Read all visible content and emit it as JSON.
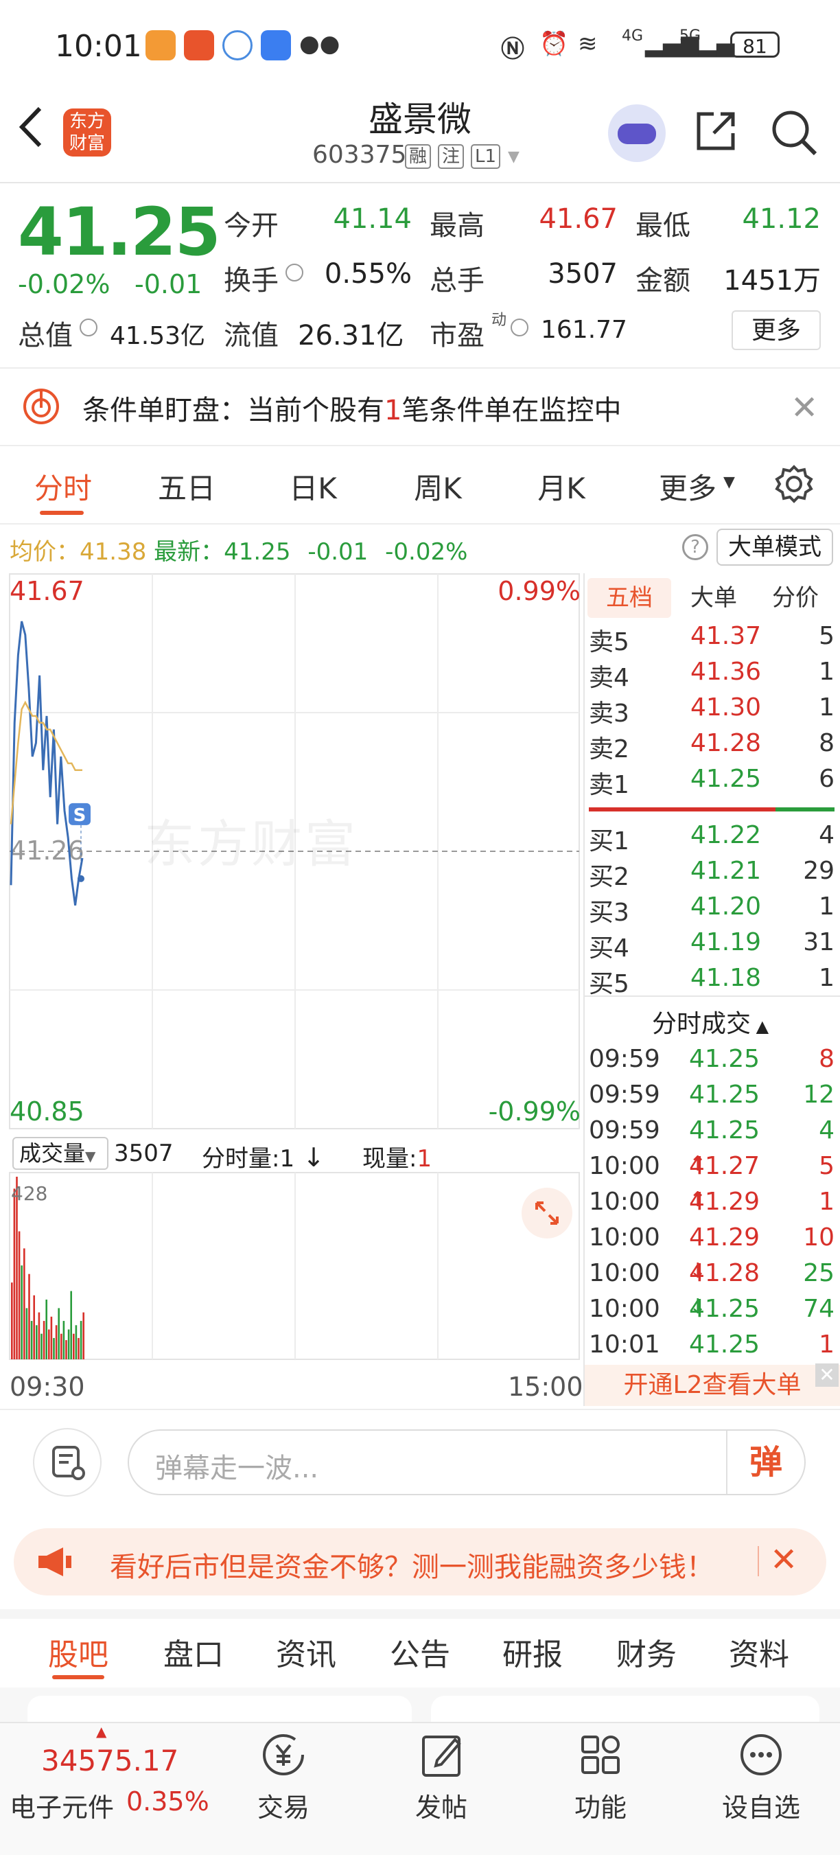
{
  "status_bar": {
    "time": "10:01",
    "network_4g": "4G",
    "network_5g": "5G",
    "battery": "81"
  },
  "header": {
    "back_icon": "chevron-left-icon",
    "logo_text": "东方财富",
    "stock_name": "盛景微",
    "stock_code": "603375",
    "tags": [
      "融",
      "注",
      "L1"
    ]
  },
  "quote": {
    "price": "41.25",
    "change_pct": "-0.02%",
    "change": "-0.01",
    "stats": [
      {
        "label": "今开",
        "value": "41.14",
        "color": "green"
      },
      {
        "label": "最高",
        "value": "41.67",
        "color": "red"
      },
      {
        "label": "最低",
        "value": "41.12",
        "color": "green"
      },
      {
        "label": "换手",
        "value": "0.55%",
        "color": "black"
      },
      {
        "label": "总手",
        "value": "3507",
        "color": "black"
      },
      {
        "label": "金额",
        "value": "1451万",
        "color": "black"
      }
    ],
    "total_value_label": "总值",
    "total_value": "41.53亿",
    "float_value_label": "流值",
    "float_value": "26.31亿",
    "pe_label": "市盈",
    "pe_sup": "动",
    "pe_value": "161.77",
    "more_button": "更多"
  },
  "condition": {
    "text_before": "条件单盯盘：当前个股有",
    "count": "1",
    "text_after": "笔条件单在监控中"
  },
  "chart_tabs": [
    "分时",
    "五日",
    "日K",
    "周K",
    "月K",
    "更多"
  ],
  "avg_line": {
    "avg_label": "均价：",
    "avg_value": "41.38",
    "latest_label": "最新：",
    "latest_value": "41.25",
    "latest_change": "-0.01",
    "latest_pct": "-0.02%",
    "big_mode": "大单模式"
  },
  "chart_data": {
    "type": "line",
    "y_top": "41.67",
    "y_mid": "41.26",
    "y_bottom": "40.85",
    "pct_top": "0.99%",
    "pct_bottom": "-0.99%",
    "ylim": [
      40.85,
      41.67
    ],
    "series": [
      {
        "values": [
          41.21,
          41.45,
          41.55,
          41.6,
          41.58,
          41.5,
          41.4,
          41.42,
          41.52,
          41.38,
          41.46,
          41.34,
          41.44,
          41.3,
          41.4,
          41.32,
          41.28,
          41.22,
          41.18,
          41.22,
          41.25
        ]
      },
      {
        "values": [
          41.3,
          41.36,
          41.42,
          41.47,
          41.48,
          41.47,
          41.46,
          41.46,
          41.45,
          41.45,
          41.44,
          41.44,
          41.43,
          41.42,
          41.41,
          41.4,
          41.39,
          41.39,
          41.38,
          41.38,
          41.38
        ]
      }
    ],
    "marker": "S",
    "volume": {
      "max_label": "428",
      "values": [
        180,
        400,
        428,
        300,
        220,
        260,
        120,
        200,
        90,
        150,
        80,
        110,
        60,
        90,
        140,
        70,
        100,
        50,
        80,
        120,
        60,
        90,
        45,
        70,
        160,
        60,
        80,
        50,
        90,
        110
      ],
      "colors": [
        "r",
        "r",
        "r",
        "r",
        "g",
        "r",
        "g",
        "r",
        "g",
        "r",
        "g",
        "r",
        "g",
        "r",
        "g",
        "r",
        "r",
        "g",
        "r",
        "g",
        "r",
        "g",
        "r",
        "g",
        "g",
        "r",
        "g",
        "r",
        "g",
        "r"
      ]
    },
    "time_start": "09:30",
    "time_end": "15:00"
  },
  "order_book": {
    "tabs": [
      "五档",
      "大单",
      "分价"
    ],
    "asks": [
      {
        "label": "卖5",
        "price": "41.37",
        "vol": "5",
        "color": "red"
      },
      {
        "label": "卖4",
        "price": "41.36",
        "vol": "1",
        "color": "red"
      },
      {
        "label": "卖3",
        "price": "41.30",
        "vol": "1",
        "color": "red"
      },
      {
        "label": "卖2",
        "price": "41.28",
        "vol": "8",
        "color": "red"
      },
      {
        "label": "卖1",
        "price": "41.25",
        "vol": "6",
        "color": "green"
      }
    ],
    "bids": [
      {
        "label": "买1",
        "price": "41.22",
        "vol": "4",
        "color": "green"
      },
      {
        "label": "买2",
        "price": "41.21",
        "vol": "29",
        "color": "green"
      },
      {
        "label": "买3",
        "price": "41.20",
        "vol": "1",
        "color": "green"
      },
      {
        "label": "买4",
        "price": "41.19",
        "vol": "31",
        "color": "green"
      },
      {
        "label": "买5",
        "price": "41.18",
        "vol": "1",
        "color": "green"
      }
    ],
    "ticks_title": "分时成交",
    "ticks": [
      {
        "time": "09:59",
        "price": "41.25",
        "arrow": "",
        "vol": "8",
        "pcolor": "green",
        "vcolor": "red"
      },
      {
        "time": "09:59",
        "price": "41.25",
        "arrow": "",
        "vol": "12",
        "pcolor": "green",
        "vcolor": "green"
      },
      {
        "time": "09:59",
        "price": "41.25",
        "arrow": "",
        "vol": "4",
        "pcolor": "green",
        "vcolor": "green"
      },
      {
        "time": "10:00",
        "price": "41.27",
        "arrow": "↑",
        "vol": "5",
        "pcolor": "red",
        "vcolor": "red"
      },
      {
        "time": "10:00",
        "price": "41.29",
        "arrow": "↑",
        "vol": "1",
        "pcolor": "red",
        "vcolor": "red"
      },
      {
        "time": "10:00",
        "price": "41.29",
        "arrow": "",
        "vol": "10",
        "pcolor": "red",
        "vcolor": "red"
      },
      {
        "time": "10:00",
        "price": "41.28",
        "arrow": "↓",
        "vol": "25",
        "pcolor": "red",
        "vcolor": "green"
      },
      {
        "time": "10:00",
        "price": "41.25",
        "arrow": "↓",
        "vol": "74",
        "pcolor": "green",
        "vcolor": "green"
      },
      {
        "time": "10:01",
        "price": "41.25",
        "arrow": "",
        "vol": "1",
        "pcolor": "green",
        "vcolor": "red"
      }
    ],
    "l2_banner": "开通L2查看大单"
  },
  "volume_header": {
    "select_label": "成交量",
    "total": "3507",
    "per_label": "分时量:1",
    "now_label": "现量:",
    "now_value": "1"
  },
  "watermark": "东方财富",
  "comment": {
    "placeholder": "弹幕走一波...",
    "danmu_button": "弹"
  },
  "promo": {
    "text": "看好后市但是资金不够？测一测我能融资多少钱！"
  },
  "bottom_tabs": [
    "股吧",
    "盘口",
    "资讯",
    "公告",
    "研报",
    "财务",
    "资料"
  ],
  "bottom_nav": {
    "index_value": "34575.17",
    "index_name": "电子元件",
    "index_pct": "0.35%",
    "items": [
      {
        "label": "交易",
        "icon": "yen-circle-icon"
      },
      {
        "label": "发帖",
        "icon": "edit-icon"
      },
      {
        "label": "功能",
        "icon": "grid-icon"
      },
      {
        "label": "设自选",
        "icon": "more-circle-icon"
      }
    ]
  },
  "colors": {
    "red": "#d7302a",
    "green": "#2a9c3c",
    "accent": "#e8542c",
    "price_line": "#3a6db5",
    "avg_line": "#e3b65a"
  }
}
